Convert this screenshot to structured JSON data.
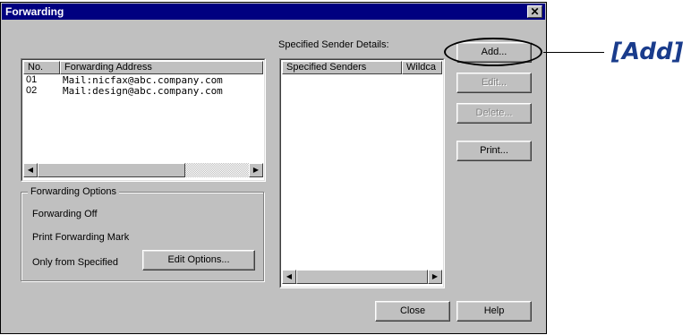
{
  "window": {
    "title": "Forwarding",
    "close_glyph": "✕"
  },
  "forwarding_list": {
    "columns": [
      "No.",
      "Forwarding Address"
    ],
    "rows": [
      {
        "no": "01",
        "address": "Mail:nicfax@abc.company.com"
      },
      {
        "no": "02",
        "address": "Mail:design@abc.company.com"
      }
    ]
  },
  "sender_details": {
    "label": "Specified Sender Details:",
    "columns": [
      "Specified Senders",
      "Wildca"
    ]
  },
  "options": {
    "legend": "Forwarding Options",
    "lines": [
      "Forwarding Off",
      "Print Forwarding Mark",
      "Only from Specified"
    ],
    "edit_button": "Edit Options..."
  },
  "buttons": {
    "add": "Add...",
    "edit": "Edit...",
    "delete": "Delete...",
    "print": "Print...",
    "close": "Close",
    "help": "Help"
  },
  "annotation": {
    "label": "[Add]"
  },
  "icons": {
    "scroll_left": "◀",
    "scroll_right": "▶"
  },
  "colors": {
    "titlebar": "#000080",
    "face": "#c0c0c0",
    "annotation": "#1a3c8c"
  }
}
